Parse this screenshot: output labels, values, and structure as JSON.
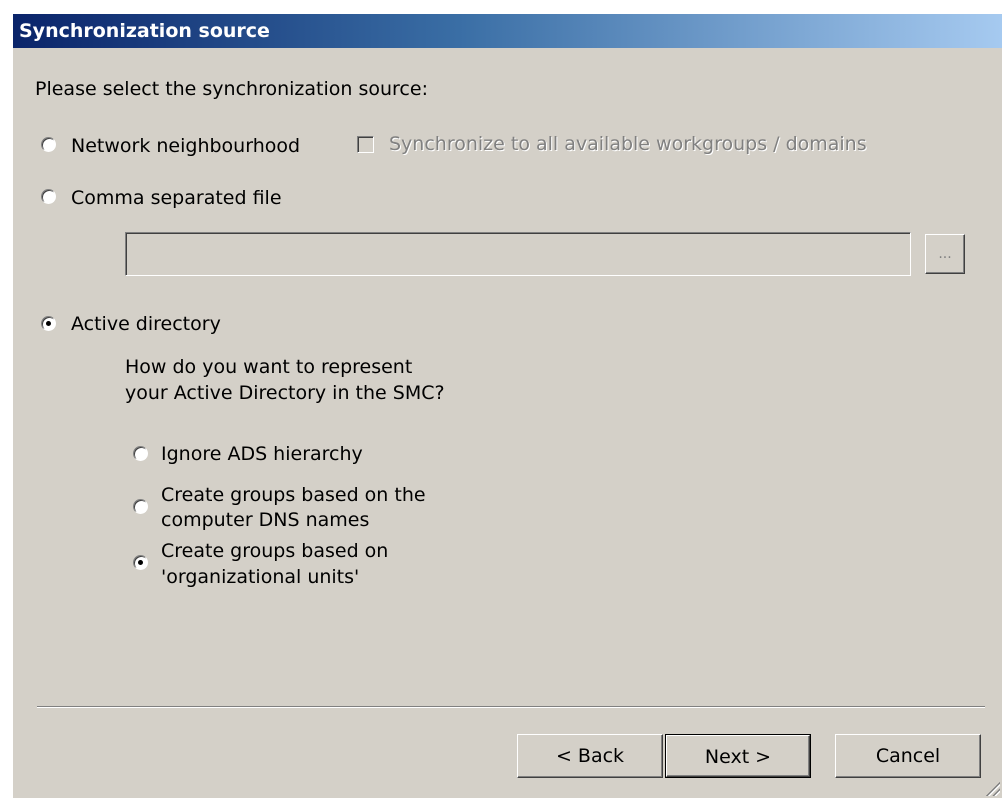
{
  "dialog": {
    "title": "Synchronization source",
    "prompt": "Please select the synchronization source:"
  },
  "sources": {
    "network": {
      "label": "Network neighbourhood",
      "checked": false
    },
    "sync_all": {
      "label": "Synchronize to all available workgroups / domains",
      "checked": false,
      "disabled": true
    },
    "csv": {
      "label": "Comma separated file",
      "checked": false
    },
    "csv_path": {
      "value": "",
      "disabled": true
    },
    "browse_label": "...",
    "ad": {
      "label": "Active directory",
      "checked": true
    }
  },
  "ad_options": {
    "question_line1": "How do you want to represent",
    "question_line2": "your Active Directory in the SMC?",
    "ignore": {
      "label": "Ignore ADS hierarchy",
      "checked": false
    },
    "dns": {
      "label_line1": "Create groups based on the",
      "label_line2": "computer DNS names",
      "checked": false
    },
    "ou": {
      "label_line1": "Create groups based on",
      "label_line2": "'organizational units'",
      "checked": true
    }
  },
  "buttons": {
    "back": "< Back",
    "next": "Next >",
    "cancel": "Cancel"
  },
  "colors": {
    "dialog_bg": "#d4d0c8",
    "title_start": "#0a246a",
    "title_end": "#a6caf0",
    "disabled_text": "#808080"
  }
}
